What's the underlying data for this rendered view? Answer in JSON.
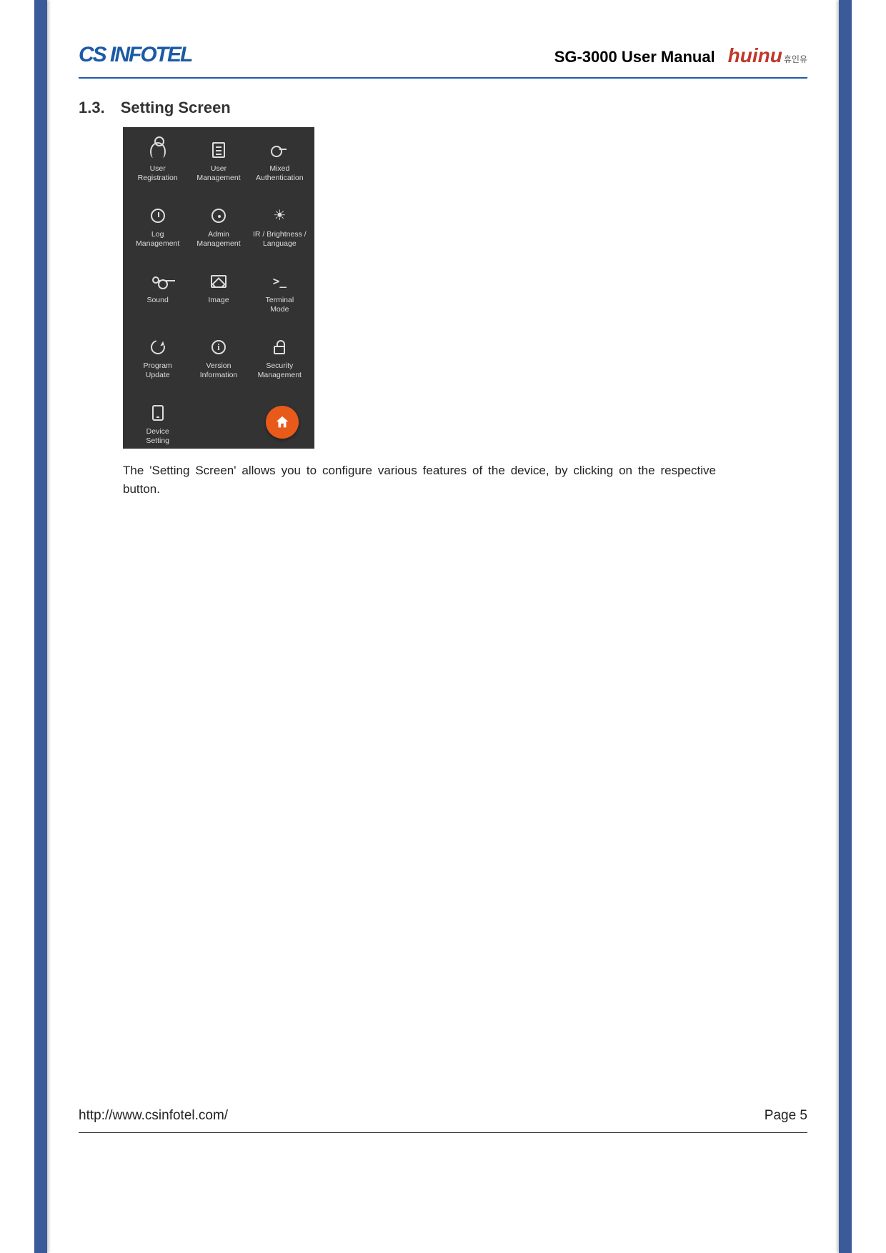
{
  "header": {
    "left_logo_text": "CS INFOTEL",
    "doc_title": "SG-3000 User Manual",
    "right_logo_text": "huinu",
    "right_logo_suffix": "휴인유"
  },
  "section": {
    "number": "1.3.",
    "title": "Setting Screen"
  },
  "settings_grid": [
    {
      "label": "User\nRegistration",
      "icon": "user"
    },
    {
      "label": "User\nManagement",
      "icon": "doc"
    },
    {
      "label": "Mixed\nAuthentication",
      "icon": "key"
    },
    {
      "label": "Log\nManagement",
      "icon": "clock"
    },
    {
      "label": "Admin\nManagement",
      "icon": "admin"
    },
    {
      "label": "IR / Brightness /\nLanguage",
      "icon": "bright"
    },
    {
      "label": "Sound",
      "icon": "sound"
    },
    {
      "label": "Image",
      "icon": "image"
    },
    {
      "label": "Terminal\nMode",
      "icon": "terminal"
    },
    {
      "label": "Program\nUpdate",
      "icon": "refresh"
    },
    {
      "label": "Version\nInformation",
      "icon": "info"
    },
    {
      "label": "Security\nManagement",
      "icon": "lock"
    },
    {
      "label": "Device\nSetting",
      "icon": "device"
    }
  ],
  "home_button": {
    "name": "home"
  },
  "body_text": "The 'Setting Screen' allows you to configure various features of the device, by clicking on the respective button.",
  "footer": {
    "url": "http://www.csinfotel.com/",
    "page_label": "Page",
    "page_number": "5"
  }
}
